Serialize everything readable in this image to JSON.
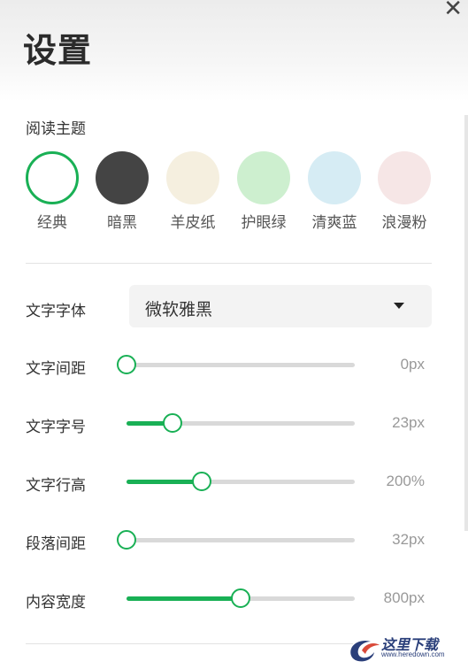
{
  "header": {
    "title": "设置",
    "close_label": "✕"
  },
  "theme_section": {
    "label": "阅读主题",
    "themes": [
      {
        "label": "经典",
        "color": "#ffffff",
        "selected": true
      },
      {
        "label": "暗黑",
        "color": "#444444",
        "selected": false
      },
      {
        "label": "羊皮纸",
        "color": "#f5efdf",
        "selected": false
      },
      {
        "label": "护眼绿",
        "color": "#cdefcf",
        "selected": false
      },
      {
        "label": "清爽蓝",
        "color": "#d6ecf4",
        "selected": false
      },
      {
        "label": "浪漫粉",
        "color": "#f6e6e6",
        "selected": false
      }
    ]
  },
  "font_family": {
    "label": "文字字体",
    "value": "微软雅黑"
  },
  "sliders": [
    {
      "label": "文字间距",
      "value_text": "0px",
      "level": 0.0
    },
    {
      "label": "文字字号",
      "value_text": "23px",
      "level": 0.2
    },
    {
      "label": "文字行高",
      "value_text": "200%",
      "level": 0.33
    },
    {
      "label": "段落间距",
      "value_text": "32px",
      "level": 0.0
    },
    {
      "label": "内容宽度",
      "value_text": "800px",
      "level": 0.5
    }
  ],
  "colors": {
    "accent": "#19b055"
  },
  "watermark": {
    "text": "这里下载",
    "sub": "www.heredown.com"
  }
}
